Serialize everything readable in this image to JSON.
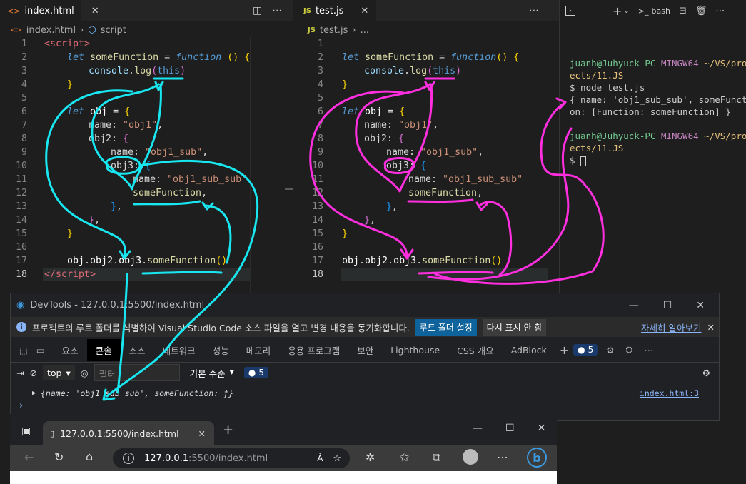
{
  "left_editor": {
    "tab_label": "index.html",
    "breadcrumb_file": "index.html",
    "breadcrumb_symbol": "script",
    "line_numbers": [
      "1",
      "2",
      "3",
      "4",
      "5",
      "6",
      "7",
      "8",
      "9",
      "10",
      "11",
      "12",
      "13",
      "14",
      "15",
      "16",
      "17",
      "18"
    ]
  },
  "right_editor": {
    "tab_prefix": "JS",
    "tab_label": "test.js",
    "breadcrumb_prefix": "JS",
    "breadcrumb_file": "test.js",
    "breadcrumb_more": "...",
    "line_numbers": [
      "1",
      "2",
      "3",
      "4",
      "5",
      "6",
      "7",
      "8",
      "9",
      "10",
      "11",
      "12",
      "13",
      "14",
      "15",
      "16",
      "17",
      "18"
    ]
  },
  "terminal": {
    "shell_label": "bash",
    "lines": [
      {
        "user": "juanh@Juhyuck-PC",
        "env": "MINGW64",
        "path": "~/VS/proj"
      },
      {
        "text": "ects/11.JS"
      },
      {
        "text": "$ node test.js"
      },
      {
        "text": "{ name: 'obj1_sub_sub', someFuncti"
      },
      {
        "text": "on: [Function: someFunction] }"
      },
      {
        "text": ""
      },
      {
        "user": "juanh@Juhyuck-PC",
        "env": "MINGW64",
        "path": "~/VS/proj"
      },
      {
        "text": "ects/11.JS"
      },
      {
        "text": "$ "
      }
    ]
  },
  "devtools": {
    "title": "DevTools - 127.0.0.1:5500/index.html",
    "info_text": "프로젝트의 루트 폴더를 식별하여 Visual Studio Code 소스 파일을 열고 변경 내용을 동기화합니다.",
    "set_root_button": "루트 폴더 설정",
    "dont_show_button": "다시 표시 안 함",
    "learn_more_link": "자세히 알아보기",
    "tabs": [
      "요소",
      "콘솔",
      "소스",
      "네트워크",
      "성능",
      "메모리",
      "응용 프로그램",
      "보안",
      "Lighthouse",
      "CSS 개요",
      "AdBlock"
    ],
    "active_tab": "콘솔",
    "issues_count": "5",
    "context_select": "top",
    "filter_placeholder": "필터",
    "level_select": "기본 수준",
    "filter_issues_count": "5",
    "log_entry": "{name: 'obj1_sub_sub', someFunction: ƒ}",
    "log_source": "index.html:3",
    "prompt_symbol": "›"
  },
  "browser": {
    "tab_title": "127.0.0.1:5500/index.html",
    "url_host": "127.0.0.1",
    "url_rest": ":5500/index.html"
  }
}
